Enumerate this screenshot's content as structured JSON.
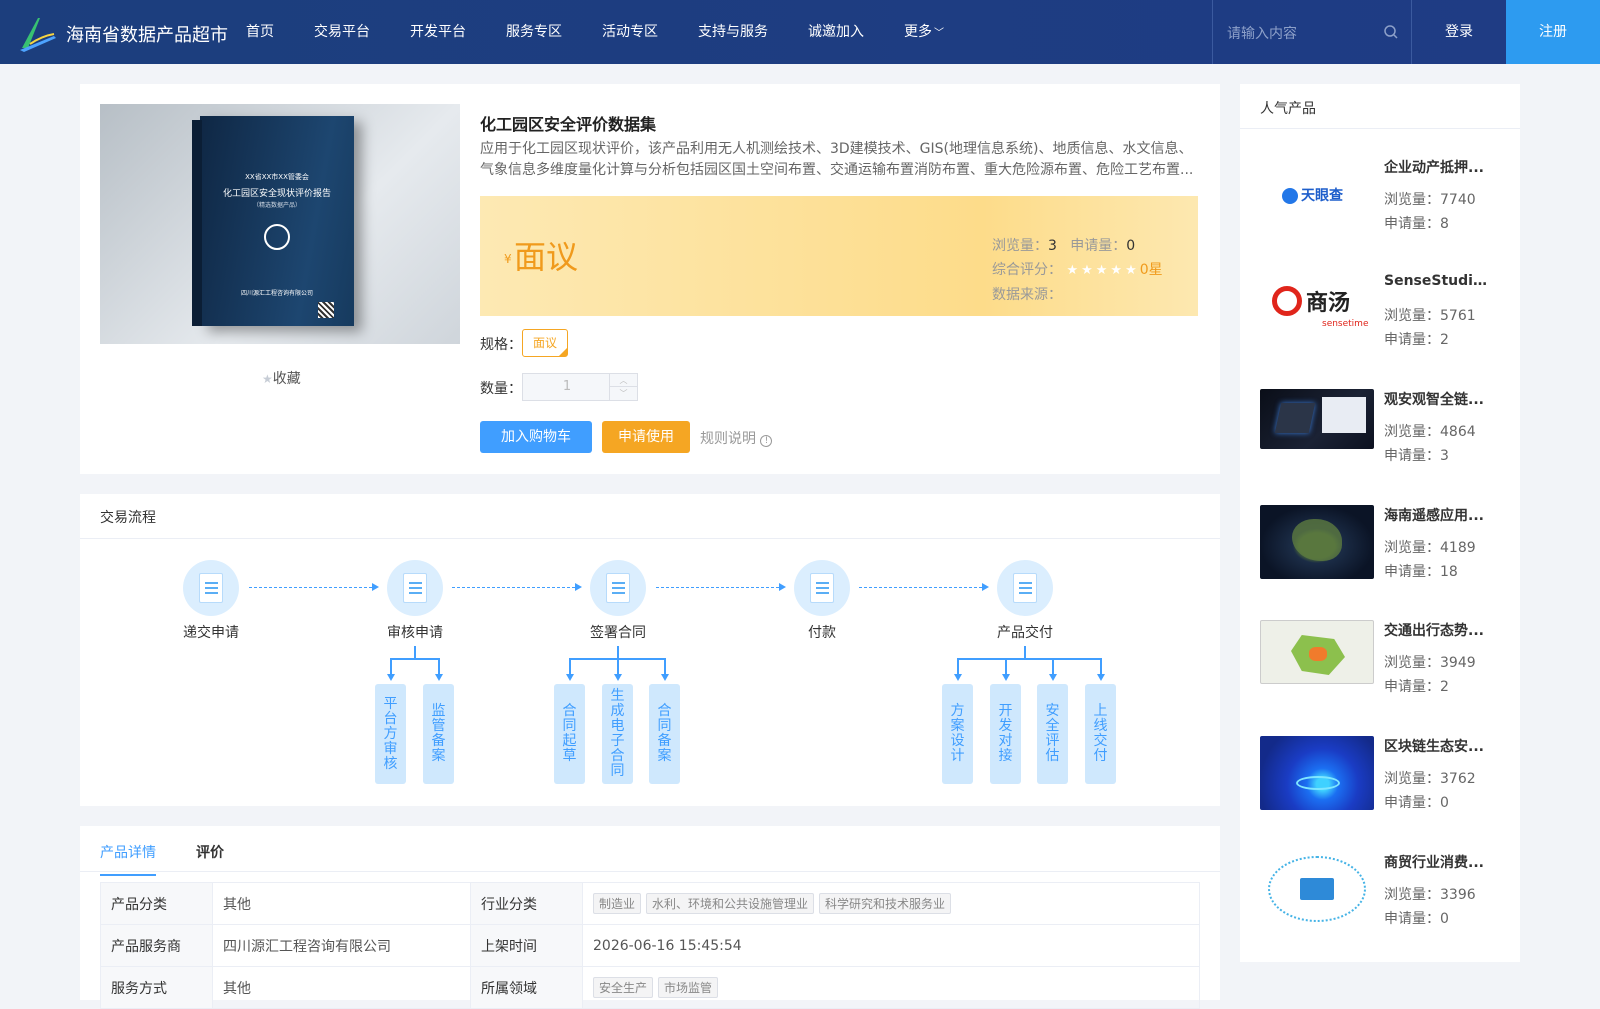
{
  "header": {
    "brand": "海南省数据产品超市",
    "nav": [
      "首页",
      "交易平台",
      "开发平台",
      "服务专区",
      "活动专区",
      "支持与服务",
      "诚邀加入",
      "更多"
    ],
    "search_placeholder": "请输入内容",
    "login": "登录",
    "register": "注册"
  },
  "product": {
    "image_text": {
      "line1": "XX省XX市XX管委会",
      "line2": "化工园区安全现状评价报告",
      "line3": "（精选数据产品）",
      "line4": "四川源汇工程咨询有限公司"
    },
    "collect": "收藏",
    "title": "化工园区安全评价数据集",
    "description": "应用于化工园区现状评价，该产品利用无人机测绘技术、3D建模技术、GIS(地理信息系统)、地质信息、水文信息、气象信息多维度量化计算与分析包括园区国土空间布置、交通运输布置消防布置、重大危险源布置、危险工艺布置...",
    "price_symbol": "¥",
    "price": "面议",
    "views_label": "浏览量：",
    "views": "3",
    "applies_label": "申请量：",
    "applies": "0",
    "rating_label": "综合评分：",
    "rating_value": "0星",
    "rating": 0,
    "source_label": "数据来源：",
    "spec_label": "规格：",
    "spec": "面议",
    "qty_label": "数量：",
    "qty": "1",
    "btn_cart": "加入购物车",
    "btn_apply": "申请使用",
    "rule": "规则说明"
  },
  "flow": {
    "title": "交易流程",
    "steps": [
      "递交申请",
      "审核申请",
      "签署合同",
      "付款",
      "产品交付"
    ],
    "subs": {
      "review": [
        "平台方审核",
        "监管备案"
      ],
      "contract": [
        "合同起草",
        "生成电子合同",
        "合同备案"
      ],
      "deliver": [
        "方案设计",
        "开发对接",
        "安全评估",
        "上线交付"
      ]
    }
  },
  "tabs": [
    "产品详情",
    "评价"
  ],
  "detail": {
    "rows": [
      {
        "k1": "产品分类",
        "v1": "其他",
        "k2": "行业分类",
        "chips2": [
          "制造业",
          "水利、环境和公共设施管理业",
          "科学研究和技术服务业"
        ]
      },
      {
        "k1": "产品服务商",
        "v1": "四川源汇工程咨询有限公司",
        "k2": "上架时间",
        "v2": "2026-06-16 15:45:54"
      },
      {
        "k1": "服务方式",
        "v1": "其他",
        "k2": "所属领域",
        "chips2": [
          "安全生产",
          "市场监管"
        ]
      }
    ]
  },
  "sidebar": {
    "title": "人气产品",
    "items": [
      {
        "name": "企业动产抵押...",
        "views": "浏览量：7740",
        "applies": "申请量：8"
      },
      {
        "name": "SenseStudio...",
        "views": "浏览量：5761",
        "applies": "申请量：2"
      },
      {
        "name": "观安观智全链...",
        "views": "浏览量：4864",
        "applies": "申请量：3"
      },
      {
        "name": "海南遥感应用...",
        "views": "浏览量：4189",
        "applies": "申请量：18"
      },
      {
        "name": "交通出行态势...",
        "views": "浏览量：3949",
        "applies": "申请量：2"
      },
      {
        "name": "区块链生态安...",
        "views": "浏览量：3762",
        "applies": "申请量：0"
      },
      {
        "name": "商贸行业消费...",
        "views": "浏览量：3396",
        "applies": "申请量：0"
      }
    ],
    "logo_texts": {
      "tianyancha": "天眼查",
      "shangtang": "商汤",
      "sensetime": "sensetime"
    }
  }
}
